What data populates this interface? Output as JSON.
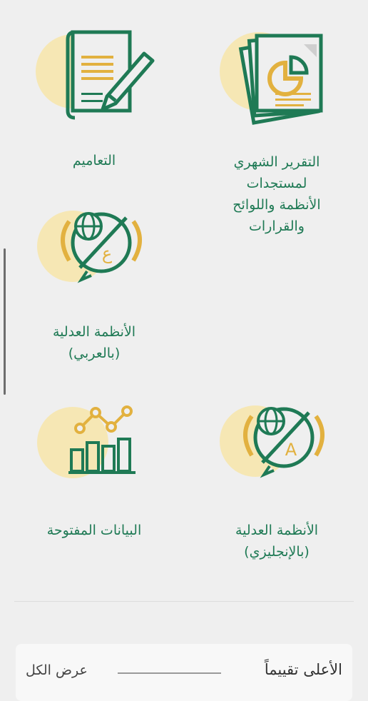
{
  "services": [
    {
      "id": "monthly-report",
      "label": "التقرير الشهري\nلمستجدات\nالأنظمة واللوائح\nوالقرارات",
      "icon": "report-pie-icon"
    },
    {
      "id": "circulars",
      "label": "التعاميم",
      "icon": "document-pen-icon"
    },
    {
      "id": "judicial-arabic",
      "label": "الأنظمة العدلية\n(بالعربي)",
      "icon": "globe-translate-arabic-icon"
    },
    {
      "id": "judicial-english",
      "label": "الأنظمة العدلية\n(بالإنجليزي)",
      "icon": "globe-translate-english-icon"
    },
    {
      "id": "open-data",
      "label": "البيانات المفتوحة",
      "icon": "bar-chart-icon"
    }
  ],
  "icon_glyphs": {
    "arabic": "ع",
    "english": "A"
  },
  "colors": {
    "green": "#1f7a55",
    "gold": "#e2b13f",
    "gold_light": "#f6e7b4"
  },
  "section": {
    "title": "الأعلى تقييماً",
    "view_all": "عرض الكل"
  }
}
